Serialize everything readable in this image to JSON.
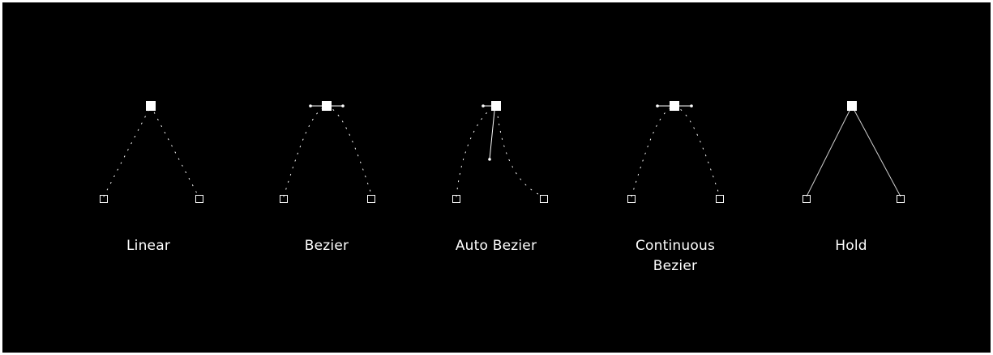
{
  "canvas": {
    "background": "#000000",
    "stroke_color": "#ffffff"
  },
  "interpolation_types": [
    {
      "label": "Linear"
    },
    {
      "label": "Bezier"
    },
    {
      "label": "Auto Bezier"
    },
    {
      "label": "Continuous Bezier"
    },
    {
      "label": "Hold"
    }
  ]
}
